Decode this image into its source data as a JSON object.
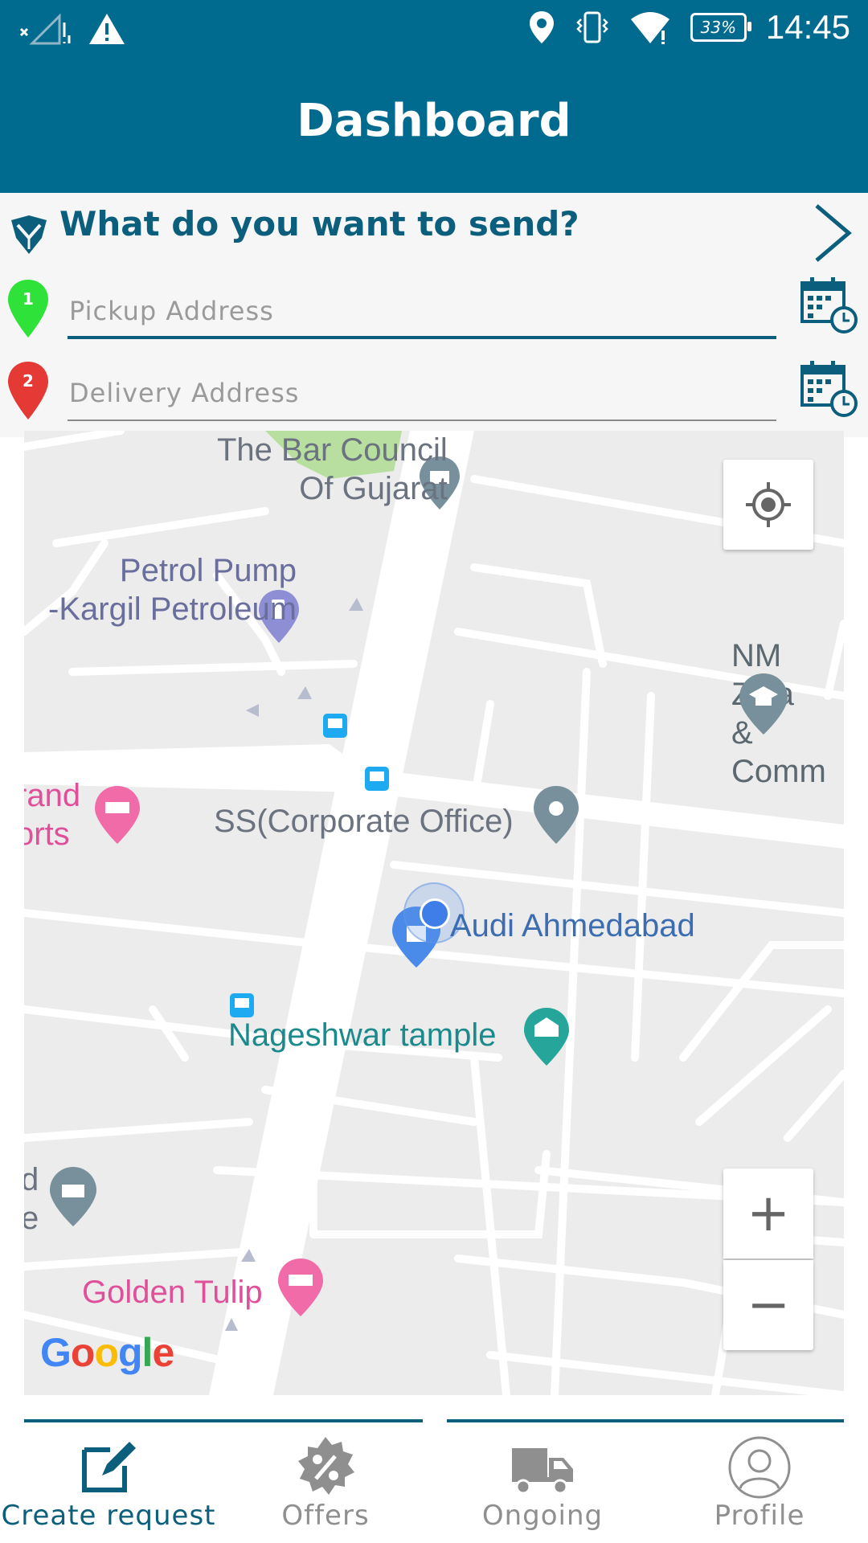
{
  "status_bar": {
    "time": "14:45",
    "battery": "33%"
  },
  "header": {
    "title": "Dashboard"
  },
  "question": {
    "text": "What do you want to send?"
  },
  "pickup": {
    "number": "1",
    "placeholder": "Pickup Address",
    "value": ""
  },
  "delivery": {
    "number": "2",
    "placeholder": "Delivery Address",
    "value": ""
  },
  "map": {
    "places": {
      "bar_council": "The Bar Council\nOf Gujarat",
      "petrol_pump": "Petrol Pump\n-Kargil Petroleum",
      "nm_zala": "NM Zala\n& Comm",
      "grand_resorts": "rand\norts",
      "ss_office": "SS(Corporate Office)",
      "audi": "Audi Ahmedabad",
      "nageshwar": "Nageshwar tample",
      "partial_d": "d\ne",
      "golden_tulip": "Golden Tulip"
    },
    "zoom_in": "+",
    "zoom_out": "−",
    "attribution": "Google"
  },
  "bottom_nav": {
    "items": [
      {
        "label": "Create request",
        "icon": "edit-icon",
        "active": true
      },
      {
        "label": "Offers",
        "icon": "percent-badge-icon",
        "active": false
      },
      {
        "label": "Ongoing",
        "icon": "truck-icon",
        "active": false
      },
      {
        "label": "Profile",
        "icon": "user-icon",
        "active": false
      }
    ]
  },
  "colors": {
    "primary": "#006b8f",
    "accent": "#0c5f7c",
    "pickup_pin": "#2ee23a",
    "delivery_pin": "#e53935"
  }
}
